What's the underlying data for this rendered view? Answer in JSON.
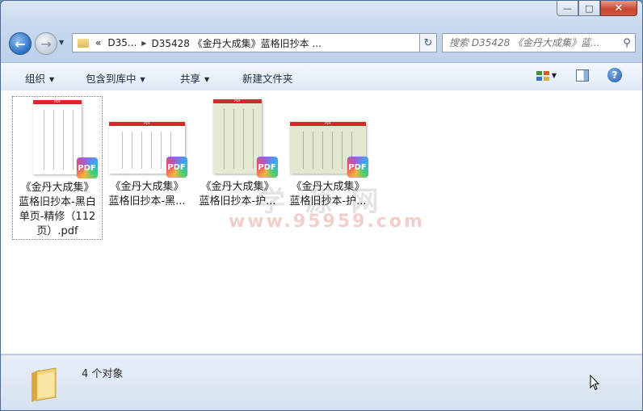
{
  "window": {
    "caption_buttons": [
      "minimize",
      "maximize",
      "close"
    ]
  },
  "nav": {
    "breadcrumb": [
      "D35...",
      "D35428 《金丹大成集》蓝格旧抄本 ..."
    ],
    "overflow": "«",
    "search_placeholder": "搜索 D35428 《金丹大成集》蓝..."
  },
  "toolbar": {
    "organize": "组织",
    "include_library": "包含到库中",
    "share": "共享",
    "new_folder": "新建文件夹"
  },
  "files": [
    {
      "line1": "《金丹大成集》",
      "line2": "蓝格旧抄本-黑白",
      "line3": "单页-精修（112",
      "line4": "页）.pdf",
      "page_color": "#ffffff",
      "selected": true
    },
    {
      "line1": "《金丹大成集》",
      "line2": "蓝格旧抄本-黑...",
      "line3": "",
      "line4": "",
      "page_color": "#ffffff",
      "selected": false
    },
    {
      "line1": "《金丹大成集》",
      "line2": "蓝格旧抄本-护...",
      "line3": "",
      "line4": "",
      "page_color": "#e3ecd3",
      "selected": false
    },
    {
      "line1": "《金丹大成集》",
      "line2": "蓝格旧抄本-护...",
      "line3": "",
      "line4": "",
      "page_color": "#e1e8cf",
      "selected": false
    }
  ],
  "badge_text": "PDF",
  "page_band_text": "PDF",
  "watermark": {
    "line1": "学 源 网",
    "line2": "www.95959.com"
  },
  "details": {
    "status": "4 个对象"
  },
  "icons": {
    "back": "back-arrow-icon",
    "forward": "forward-arrow-icon",
    "refresh": "refresh-icon",
    "search": "magnifier-icon",
    "help": "help-icon"
  }
}
